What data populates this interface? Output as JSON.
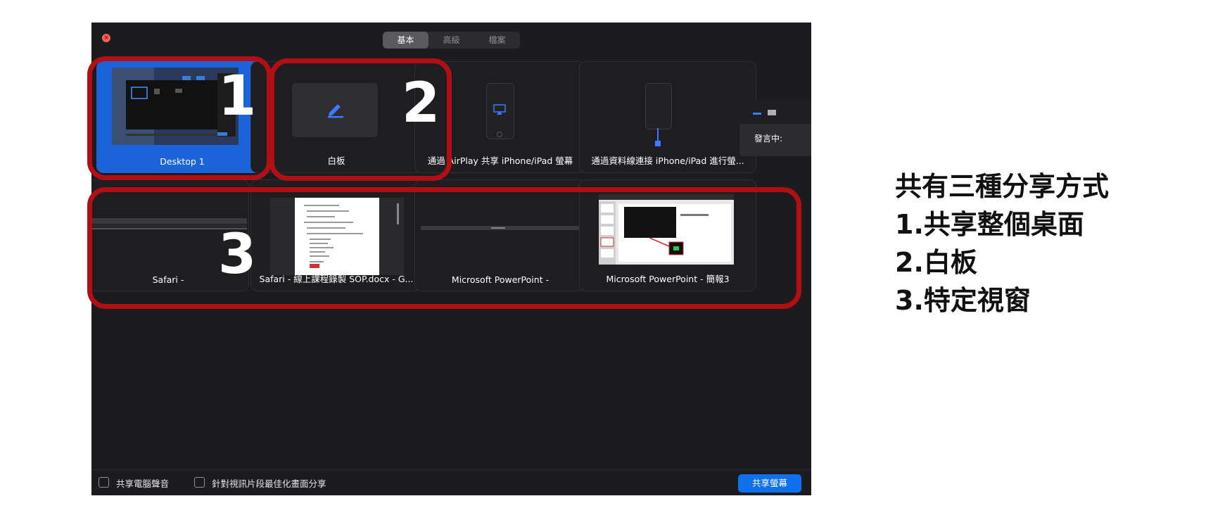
{
  "window": {
    "tabs": [
      {
        "label": "基本"
      },
      {
        "label": "高級"
      },
      {
        "label": "檔案"
      }
    ],
    "tiles_row1": [
      {
        "caption": "Desktop 1"
      },
      {
        "caption": "白板"
      },
      {
        "caption": "通過 AirPlay 共享 iPhone/iPad 螢幕"
      },
      {
        "caption": "通過資料線連接 iPhone/iPad 進行螢..."
      }
    ],
    "tiles_row2": [
      {
        "caption": "Safari -"
      },
      {
        "caption": "Safari - 線上課程錄製 SOP.docx - G..."
      },
      {
        "caption": "Microsoft PowerPoint -"
      },
      {
        "caption": "Microsoft PowerPoint - 簡報3"
      }
    ],
    "popup_text": "發言中:",
    "footer": {
      "share_audio_label": "共享電腦聲音",
      "optimize_video_label": "針對視訊片段最佳化畫面分享",
      "share_button_label": "共享螢幕"
    }
  },
  "numbers": {
    "one": "1",
    "two": "2",
    "three": "3"
  },
  "annotation": {
    "lines": [
      "共有三種分享方式",
      "1.共享整個桌面",
      "2.白板",
      "3.特定視窗"
    ]
  },
  "colors": {
    "accent": "#0e71eb",
    "selected": "#1a63d8",
    "highlight_box": "#b10f14",
    "background": "#1c1c1e"
  }
}
